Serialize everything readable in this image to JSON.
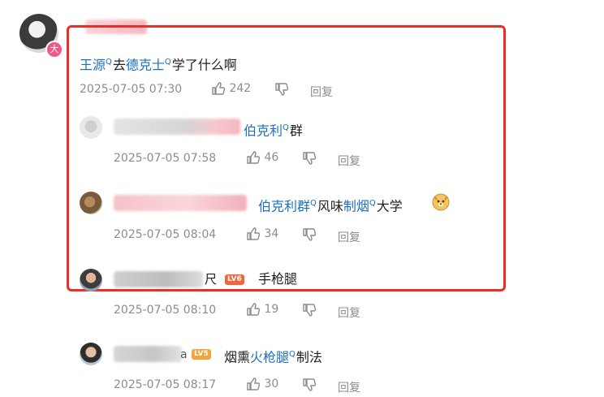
{
  "main_comment": {
    "badge": "大",
    "text_topic1": "王源",
    "text_mid": "去",
    "text_topic2": "德克士",
    "text_end": "学了什么啊",
    "time": "2025-07-05 07:30",
    "likes": "242",
    "reply": "回复"
  },
  "replies": [
    {
      "topic": "伯克利",
      "text_end": "群",
      "time": "2025-07-05 07:58",
      "likes": "46",
      "reply": "回复"
    },
    {
      "topic": "伯克利群",
      "text_mid": "风味",
      "topic2": "制烟",
      "text_end": "大学",
      "time": "2025-07-05 08:04",
      "likes": "34",
      "reply": "回复"
    },
    {
      "name_tail": "尺",
      "level": "LV6",
      "text": "手枪腿",
      "time": "2025-07-05 08:10",
      "likes": "19",
      "reply": "回复"
    },
    {
      "name_tail": "a",
      "level": "LV5",
      "text_start": "烟熏",
      "topic": "火枪腿",
      "text_end": "制法",
      "time": "2025-07-05 08:17",
      "likes": "30",
      "reply": "回复"
    }
  ],
  "topic_mark": "Q",
  "colors": {
    "topic": "#1d6fbf",
    "frame": "#e63027",
    "lv6": "#f0673a",
    "lv5": "#f2a43a"
  },
  "icons": [
    "thumbs-up-icon",
    "thumbs-down-icon",
    "doge-emoji-icon",
    "vip-badge-icon"
  ]
}
